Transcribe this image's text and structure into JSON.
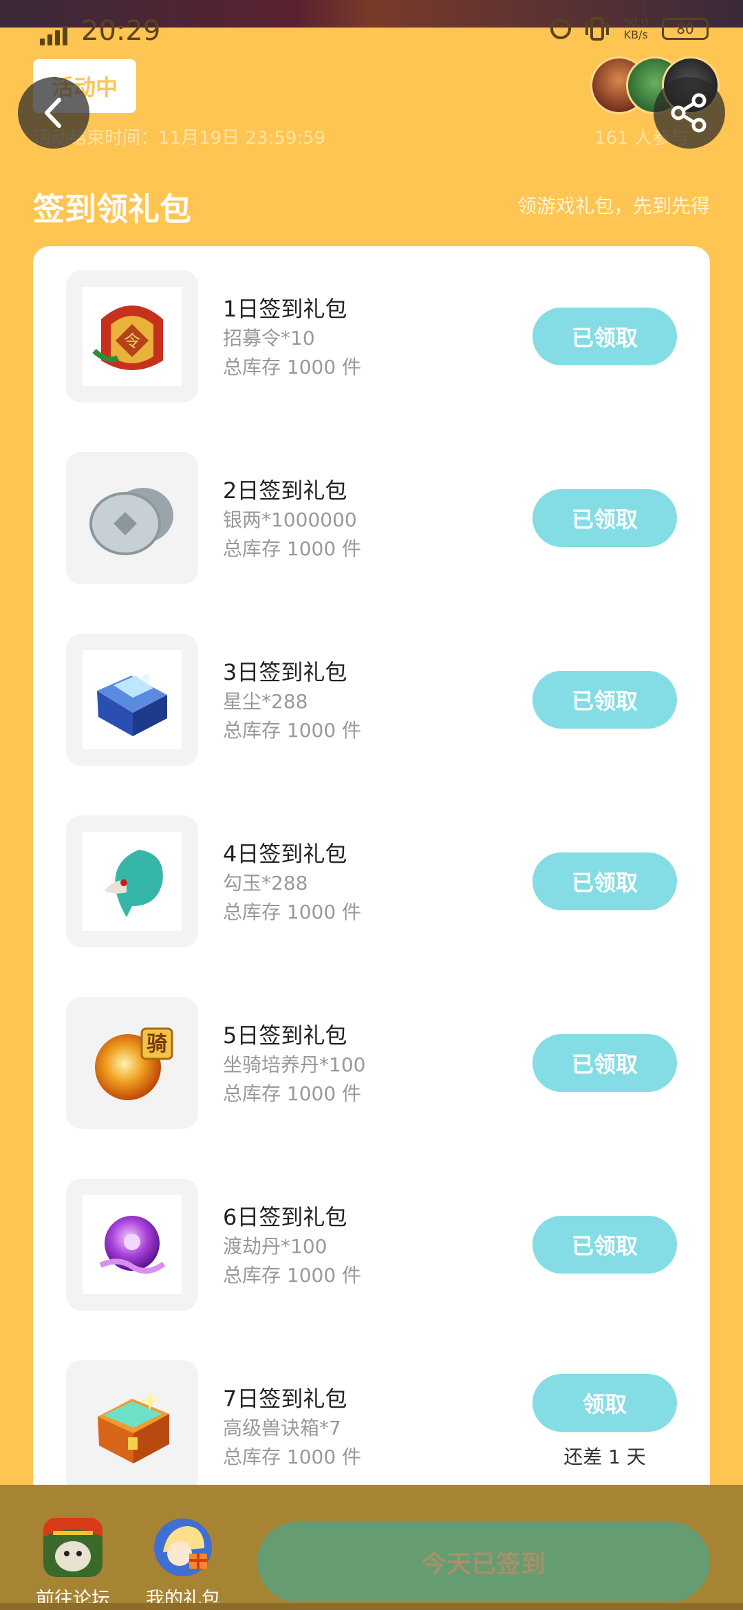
{
  "status": {
    "time": "20:29",
    "net_speed": "50.0\nKB/s",
    "battery": "80"
  },
  "header": {
    "active_tag": "活动中",
    "end_time": "活动结束时间：11月19日 23:59:59",
    "people_count": "161 人参与"
  },
  "section": {
    "title": "签到领礼包",
    "subtitle": "领游戏礼包，先到先得"
  },
  "gifts": [
    {
      "name": "1日签到礼包",
      "item": "招募令*10",
      "stock": "总库存 1000 件",
      "button": "已领取",
      "icon": "recruit-token-icon"
    },
    {
      "name": "2日签到礼包",
      "item": "银两*1000000",
      "stock": "总库存 1000 件",
      "button": "已领取",
      "icon": "silver-coin-icon"
    },
    {
      "name": "3日签到礼包",
      "item": "星尘*288",
      "stock": "总库存 1000 件",
      "button": "已领取",
      "icon": "stardust-chest-icon"
    },
    {
      "name": "4日签到礼包",
      "item": "勾玉*288",
      "stock": "总库存 1000 件",
      "button": "已领取",
      "icon": "magatama-icon"
    },
    {
      "name": "5日签到礼包",
      "item": "坐骑培养丹*100",
      "stock": "总库存 1000 件",
      "button": "已领取",
      "icon": "mount-pill-icon"
    },
    {
      "name": "6日签到礼包",
      "item": "渡劫丹*100",
      "stock": "总库存 1000 件",
      "button": "已领取",
      "icon": "tribulation-pill-icon"
    },
    {
      "name": "7日签到礼包",
      "item": "高级兽诀箱*7",
      "stock": "总库存 1000 件",
      "button": "领取",
      "note": "还差 1 天",
      "icon": "treasure-chest-icon"
    }
  ],
  "bottom": {
    "forum_label": "前往论坛",
    "my_gifts_label": "我的礼包",
    "signed_label": "今天已签到"
  },
  "colors": {
    "background": "#ffc552",
    "claim_button": "#84dde4",
    "signed_button": "#669c72",
    "bottom_bar": "#a78434"
  }
}
